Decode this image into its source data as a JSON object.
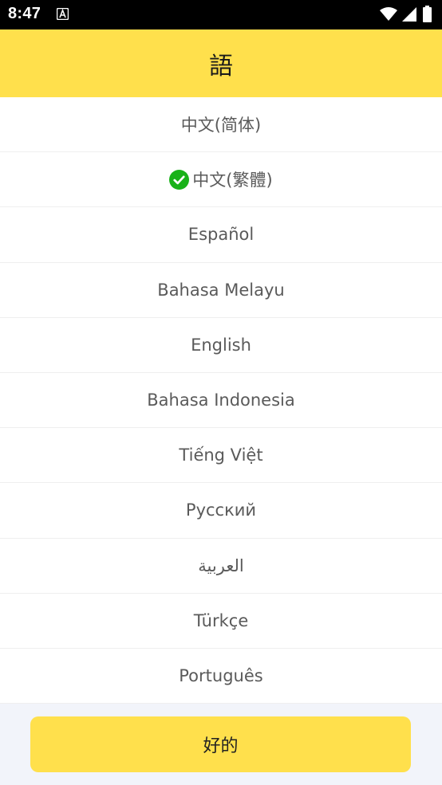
{
  "status_bar": {
    "time": "8:47",
    "notification_icon": "accessibility-a-icon",
    "icons": [
      "wifi-icon",
      "cellular-signal-icon",
      "battery-icon"
    ]
  },
  "header": {
    "title": "語",
    "background": "#ffe04c"
  },
  "languages": [
    {
      "label": "中文(简体)",
      "selected": false
    },
    {
      "label": "中文(繁體)",
      "selected": true
    },
    {
      "label": "Español",
      "selected": false
    },
    {
      "label": "Bahasa Melayu",
      "selected": false
    },
    {
      "label": "English",
      "selected": false
    },
    {
      "label": "Bahasa Indonesia",
      "selected": false
    },
    {
      "label": "Tiếng Việt",
      "selected": false
    },
    {
      "label": "Русский",
      "selected": false
    },
    {
      "label": "العربية",
      "selected": false
    },
    {
      "label": "Türkçe",
      "selected": false
    },
    {
      "label": "Português",
      "selected": false
    }
  ],
  "selected_indicator": {
    "icon": "check-circle-icon",
    "color": "#19b219"
  },
  "footer": {
    "ok_label": "好的"
  }
}
